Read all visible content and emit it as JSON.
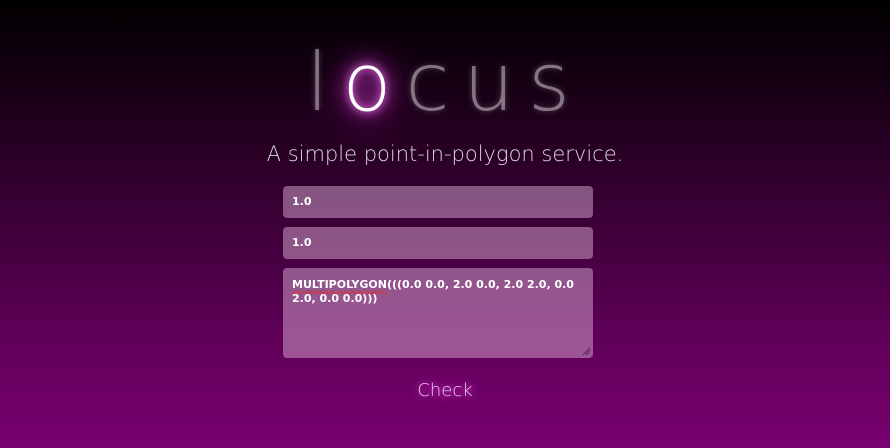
{
  "logo": {
    "before": "l",
    "glow": "o",
    "after": "cus"
  },
  "tagline": "A simple point-in-polygon service.",
  "form": {
    "x_value": "1.0",
    "y_value": "1.0",
    "polygon_keyword": "MULTIPOLYGON",
    "polygon_rest": "(((0.0 0.0, 2.0 0.0, 2.0 2.0, 0.0 2.0, 0.0 0.0)))"
  },
  "button": {
    "check_label": "Check"
  },
  "colors": {
    "glow": "#ff50ff",
    "field_bg": "#b088ad",
    "background_bottom": "#790070"
  }
}
